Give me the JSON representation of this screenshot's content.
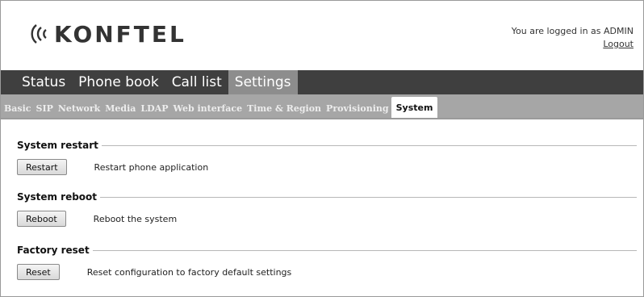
{
  "brand": {
    "logo_text": "KONFTEL"
  },
  "login": {
    "status_text": "You are logged in as ADMIN",
    "logout_label": "Logout"
  },
  "main_nav": {
    "tabs": [
      {
        "label": "Status"
      },
      {
        "label": "Phone book"
      },
      {
        "label": "Call list"
      },
      {
        "label": "Settings"
      }
    ],
    "active": "Settings"
  },
  "sub_nav": {
    "tabs": [
      {
        "label": "Basic"
      },
      {
        "label": "SIP"
      },
      {
        "label": "Network"
      },
      {
        "label": "Media"
      },
      {
        "label": "LDAP"
      },
      {
        "label": "Web interface"
      },
      {
        "label": "Time & Region"
      },
      {
        "label": "Provisioning"
      },
      {
        "label": "System"
      }
    ],
    "active": "System"
  },
  "sections": [
    {
      "title": "System restart",
      "button_label": "Restart",
      "description": "Restart phone application"
    },
    {
      "title": "System reboot",
      "button_label": "Reboot",
      "description": "Reboot the system"
    },
    {
      "title": "Factory reset",
      "button_label": "Reset",
      "description": "Reset configuration to factory default settings"
    }
  ],
  "colors": {
    "main_nav_bg": "#3f3f3f",
    "main_nav_active": "#8d8d8d",
    "sub_nav_bg": "#a6a6a6",
    "sub_nav_active": "#ffffff"
  }
}
